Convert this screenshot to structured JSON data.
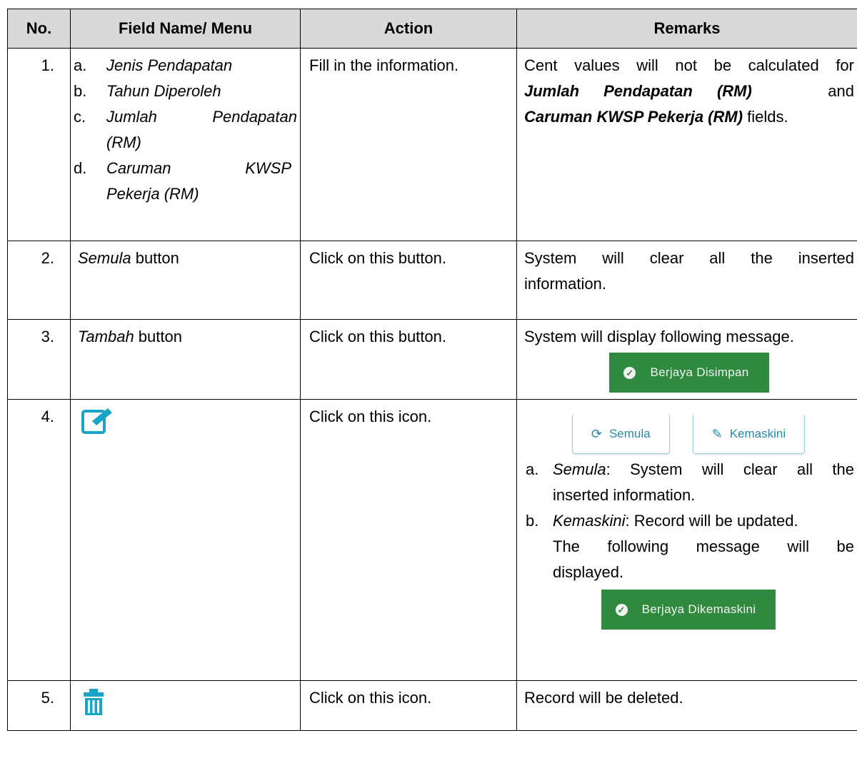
{
  "headers": {
    "no": "No.",
    "field": "Field Name/ Menu",
    "action": "Action",
    "remarks": "Remarks"
  },
  "rows": [
    {
      "no": "1.",
      "fields": [
        {
          "letter": "a.",
          "text": "Jenis Pendapatan"
        },
        {
          "letter": "b.",
          "text": "Tahun Diperoleh"
        },
        {
          "letter": "c.",
          "text_line1": "Jumlah Pendapatan",
          "text_line2": "(RM)"
        },
        {
          "letter": "d.",
          "text_line1": "Caruman KWSP",
          "text_line2": "Pekerja (RM)"
        }
      ],
      "action": "Fill in the information.",
      "remark": {
        "line1": "Cent values will not be calculated for",
        "bold1": "Jumlah Pendapatan (RM)",
        "and": "and",
        "bold2": "Caruman KWSP Pekerja (RM)",
        "tail": "fields."
      }
    },
    {
      "no": "2.",
      "field_italic": "Semula",
      "field_suffix": " button",
      "action": "Click on this button.",
      "remark_line1": "System will clear all the inserted",
      "remark_line2": "information."
    },
    {
      "no": "3.",
      "field_italic": "Tambah",
      "field_suffix": " button",
      "action": "Click on this button.",
      "remark": "System will display following message.",
      "badge": "Berjaya Disimpan"
    },
    {
      "no": "4.",
      "field_icon": "edit-icon",
      "action": "Click on this icon.",
      "buttons": {
        "reset": "Semula",
        "update": "Kemaskini"
      },
      "items": [
        {
          "letter": "a.",
          "term": "Semula",
          "line1": ": System will clear all the",
          "line2": "inserted information."
        },
        {
          "letter": "b.",
          "term": "Kemaskini",
          "line1": ": Record will be updated.",
          "line2": "The following message will be",
          "line3": "displayed."
        }
      ],
      "badge": "Berjaya Dikemaskini"
    },
    {
      "no": "5.",
      "field_icon": "trash-icon",
      "action": "Click on this icon.",
      "remark": "Record will be deleted."
    }
  ],
  "colors": {
    "header_bg": "#d9d9d9",
    "badge_green": "#2f8a3f",
    "icon_teal": "#18a5c7",
    "button_text": "#2a8aa6"
  }
}
